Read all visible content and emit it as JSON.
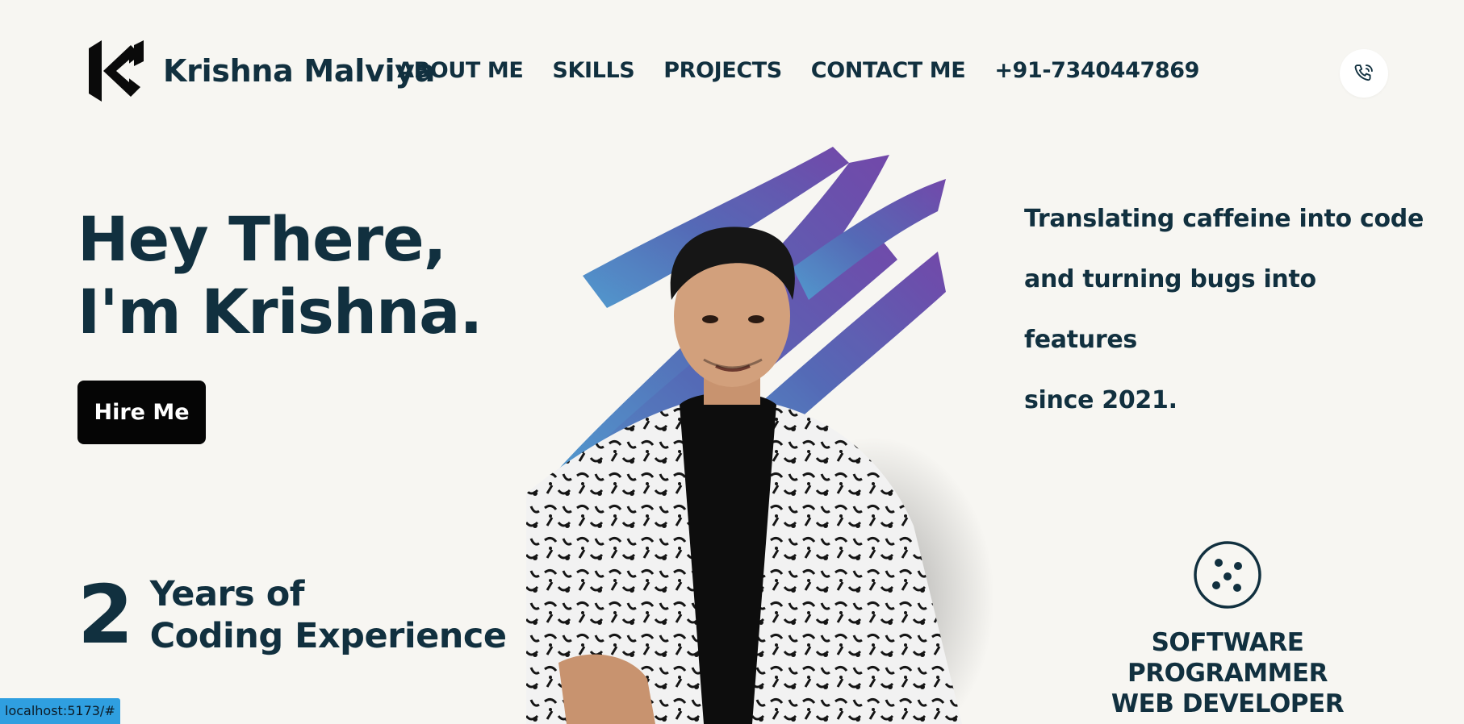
{
  "brand": {
    "name": "Krishna Malviya",
    "logo_icon": "km-logo-icon"
  },
  "nav": {
    "items": [
      {
        "label": "ABOUT ME"
      },
      {
        "label": "SKILLS"
      },
      {
        "label": "PROJECTS"
      },
      {
        "label": "CONTACT ME"
      },
      {
        "label": "+91-7340447869"
      }
    ],
    "phone_icon": "phone-icon"
  },
  "hero": {
    "line1": "Hey There,",
    "line2": "I'm Krishna.",
    "cta_label": "Hire Me"
  },
  "experience": {
    "number": "2",
    "line1": "Years of",
    "line2": "Coding Experience"
  },
  "tagline": {
    "line1": "Translating caffeine into code",
    "line2": "and turning bugs into features",
    "line3": "since 2021."
  },
  "roles": {
    "icon": "dice-circle-icon",
    "line1": "SOFTWARE PROGRAMMER",
    "line2": "WEB DEVELOPER"
  },
  "status_bar": {
    "url": "localhost:5173/#"
  },
  "colors": {
    "background": "#f7f6f2",
    "text": "#11303f",
    "button": "#050505",
    "brush_purple": "#6a43a8",
    "brush_blue": "#3f87c6"
  }
}
